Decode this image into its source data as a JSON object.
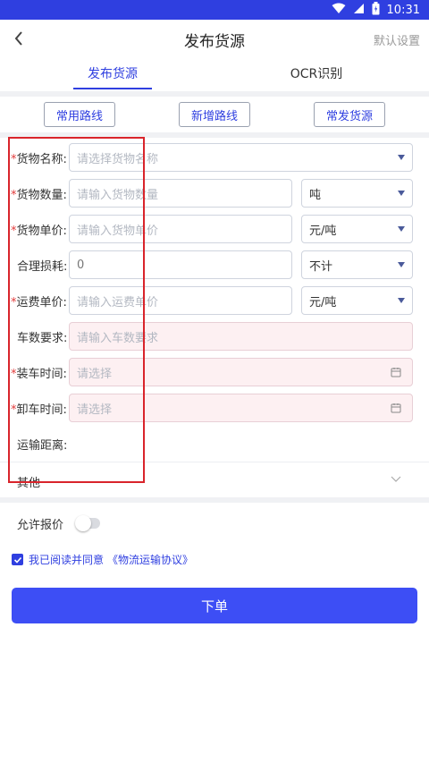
{
  "status_bar": {
    "time": "10:31",
    "icons": [
      "wifi-icon",
      "signal-icon",
      "battery-icon"
    ]
  },
  "header": {
    "title": "发布货源",
    "right_action": "默认设置"
  },
  "tabs": [
    {
      "label": "发布货源",
      "active": true
    },
    {
      "label": "OCR识别",
      "active": false
    }
  ],
  "quick_buttons": {
    "common_routes": "常用路线",
    "add_route": "新增路线",
    "frequent_cargo": "常发货源"
  },
  "form": {
    "cargo_name": {
      "label": "货物名称:",
      "placeholder": "请选择货物名称",
      "required": true
    },
    "cargo_qty": {
      "label": "货物数量:",
      "placeholder": "请输入货物数量",
      "unit": "吨",
      "required": true
    },
    "cargo_price": {
      "label": "货物单价:",
      "placeholder": "请输入货物单价",
      "unit": "元/吨",
      "required": true
    },
    "loss": {
      "label": "合理损耗:",
      "value": "0",
      "unit": "不计",
      "required": false
    },
    "freight_price": {
      "label": "运费单价:",
      "placeholder": "请输入运费单价",
      "unit": "元/吨",
      "required": true
    },
    "truck_req": {
      "label": "车数要求:",
      "placeholder": "请输入车数要求",
      "required": false
    },
    "load_time": {
      "label": "装车时间:",
      "placeholder": "请选择",
      "required": true
    },
    "unload_time": {
      "label": "卸车时间:",
      "placeholder": "请选择",
      "required": true
    },
    "distance": {
      "label": "运输距离:"
    },
    "other": {
      "label": "其他"
    }
  },
  "allow_quote": {
    "label": "允许报价",
    "on": false
  },
  "agreement": {
    "checked": true,
    "text": "我已阅读并同意",
    "link": "《物流运输协议》"
  },
  "submit": {
    "label": "下单"
  },
  "colors": {
    "primary": "#3d4ef5",
    "status_bar": "#2f3fe0",
    "required": "#e23b3b",
    "highlight_box": "#d9242b",
    "pink_field": "#fdf0f2"
  }
}
